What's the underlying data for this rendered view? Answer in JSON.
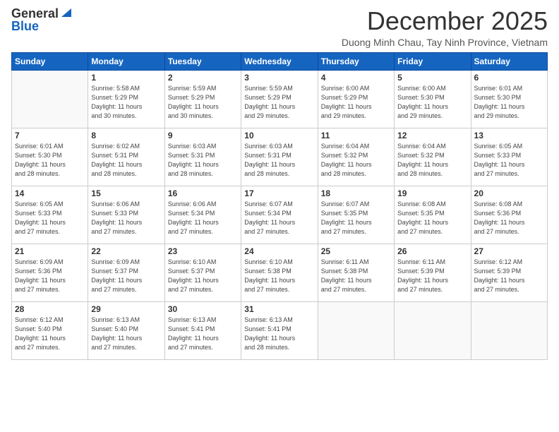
{
  "logo": {
    "general": "General",
    "blue": "Blue"
  },
  "header": {
    "month": "December 2025",
    "subtitle": "Duong Minh Chau, Tay Ninh Province, Vietnam"
  },
  "weekdays": [
    "Sunday",
    "Monday",
    "Tuesday",
    "Wednesday",
    "Thursday",
    "Friday",
    "Saturday"
  ],
  "weeks": [
    [
      {
        "day": "",
        "info": ""
      },
      {
        "day": "1",
        "info": "Sunrise: 5:58 AM\nSunset: 5:29 PM\nDaylight: 11 hours\nand 30 minutes."
      },
      {
        "day": "2",
        "info": "Sunrise: 5:59 AM\nSunset: 5:29 PM\nDaylight: 11 hours\nand 30 minutes."
      },
      {
        "day": "3",
        "info": "Sunrise: 5:59 AM\nSunset: 5:29 PM\nDaylight: 11 hours\nand 29 minutes."
      },
      {
        "day": "4",
        "info": "Sunrise: 6:00 AM\nSunset: 5:29 PM\nDaylight: 11 hours\nand 29 minutes."
      },
      {
        "day": "5",
        "info": "Sunrise: 6:00 AM\nSunset: 5:30 PM\nDaylight: 11 hours\nand 29 minutes."
      },
      {
        "day": "6",
        "info": "Sunrise: 6:01 AM\nSunset: 5:30 PM\nDaylight: 11 hours\nand 29 minutes."
      }
    ],
    [
      {
        "day": "7",
        "info": "Sunrise: 6:01 AM\nSunset: 5:30 PM\nDaylight: 11 hours\nand 28 minutes."
      },
      {
        "day": "8",
        "info": "Sunrise: 6:02 AM\nSunset: 5:31 PM\nDaylight: 11 hours\nand 28 minutes."
      },
      {
        "day": "9",
        "info": "Sunrise: 6:03 AM\nSunset: 5:31 PM\nDaylight: 11 hours\nand 28 minutes."
      },
      {
        "day": "10",
        "info": "Sunrise: 6:03 AM\nSunset: 5:31 PM\nDaylight: 11 hours\nand 28 minutes."
      },
      {
        "day": "11",
        "info": "Sunrise: 6:04 AM\nSunset: 5:32 PM\nDaylight: 11 hours\nand 28 minutes."
      },
      {
        "day": "12",
        "info": "Sunrise: 6:04 AM\nSunset: 5:32 PM\nDaylight: 11 hours\nand 28 minutes."
      },
      {
        "day": "13",
        "info": "Sunrise: 6:05 AM\nSunset: 5:33 PM\nDaylight: 11 hours\nand 27 minutes."
      }
    ],
    [
      {
        "day": "14",
        "info": "Sunrise: 6:05 AM\nSunset: 5:33 PM\nDaylight: 11 hours\nand 27 minutes."
      },
      {
        "day": "15",
        "info": "Sunrise: 6:06 AM\nSunset: 5:33 PM\nDaylight: 11 hours\nand 27 minutes."
      },
      {
        "day": "16",
        "info": "Sunrise: 6:06 AM\nSunset: 5:34 PM\nDaylight: 11 hours\nand 27 minutes."
      },
      {
        "day": "17",
        "info": "Sunrise: 6:07 AM\nSunset: 5:34 PM\nDaylight: 11 hours\nand 27 minutes."
      },
      {
        "day": "18",
        "info": "Sunrise: 6:07 AM\nSunset: 5:35 PM\nDaylight: 11 hours\nand 27 minutes."
      },
      {
        "day": "19",
        "info": "Sunrise: 6:08 AM\nSunset: 5:35 PM\nDaylight: 11 hours\nand 27 minutes."
      },
      {
        "day": "20",
        "info": "Sunrise: 6:08 AM\nSunset: 5:36 PM\nDaylight: 11 hours\nand 27 minutes."
      }
    ],
    [
      {
        "day": "21",
        "info": "Sunrise: 6:09 AM\nSunset: 5:36 PM\nDaylight: 11 hours\nand 27 minutes."
      },
      {
        "day": "22",
        "info": "Sunrise: 6:09 AM\nSunset: 5:37 PM\nDaylight: 11 hours\nand 27 minutes."
      },
      {
        "day": "23",
        "info": "Sunrise: 6:10 AM\nSunset: 5:37 PM\nDaylight: 11 hours\nand 27 minutes."
      },
      {
        "day": "24",
        "info": "Sunrise: 6:10 AM\nSunset: 5:38 PM\nDaylight: 11 hours\nand 27 minutes."
      },
      {
        "day": "25",
        "info": "Sunrise: 6:11 AM\nSunset: 5:38 PM\nDaylight: 11 hours\nand 27 minutes."
      },
      {
        "day": "26",
        "info": "Sunrise: 6:11 AM\nSunset: 5:39 PM\nDaylight: 11 hours\nand 27 minutes."
      },
      {
        "day": "27",
        "info": "Sunrise: 6:12 AM\nSunset: 5:39 PM\nDaylight: 11 hours\nand 27 minutes."
      }
    ],
    [
      {
        "day": "28",
        "info": "Sunrise: 6:12 AM\nSunset: 5:40 PM\nDaylight: 11 hours\nand 27 minutes."
      },
      {
        "day": "29",
        "info": "Sunrise: 6:13 AM\nSunset: 5:40 PM\nDaylight: 11 hours\nand 27 minutes."
      },
      {
        "day": "30",
        "info": "Sunrise: 6:13 AM\nSunset: 5:41 PM\nDaylight: 11 hours\nand 27 minutes."
      },
      {
        "day": "31",
        "info": "Sunrise: 6:13 AM\nSunset: 5:41 PM\nDaylight: 11 hours\nand 28 minutes."
      },
      {
        "day": "",
        "info": ""
      },
      {
        "day": "",
        "info": ""
      },
      {
        "day": "",
        "info": ""
      }
    ]
  ]
}
